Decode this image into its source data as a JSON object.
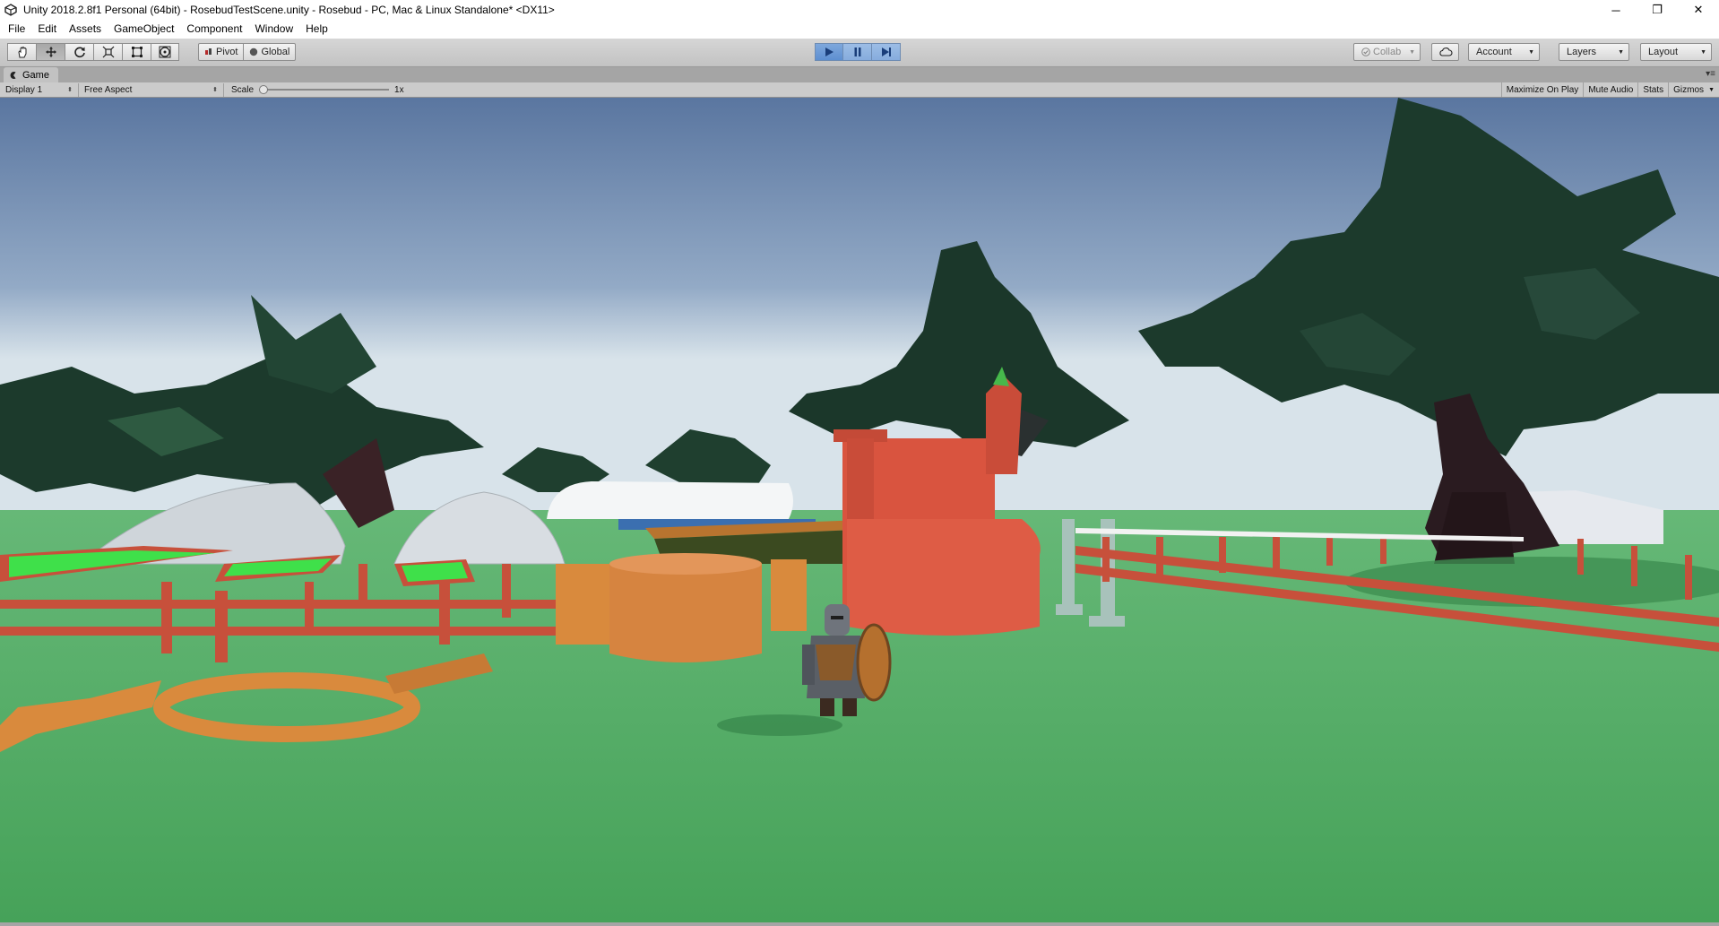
{
  "window": {
    "title": "Unity 2018.2.8f1 Personal (64bit) - RosebudTestScene.unity - Rosebud - PC, Mac & Linux Standalone* <DX11>",
    "minimize": "─",
    "maximize": "❐",
    "close": "✕"
  },
  "menu": {
    "items": [
      "File",
      "Edit",
      "Assets",
      "GameObject",
      "Component",
      "Window",
      "Help"
    ]
  },
  "toolbar": {
    "transform_tools": [
      "hand-icon",
      "move-icon",
      "rotate-icon",
      "scale-icon",
      "rect-icon",
      "transform-icon"
    ],
    "pivot_label": "Pivot",
    "global_label": "Global",
    "collab_label": "Collab",
    "account_label": "Account",
    "layers_label": "Layers",
    "layout_label": "Layout",
    "play_state": "playing"
  },
  "game_tab": {
    "label": "Game",
    "display": "Display 1",
    "aspect": "Free Aspect",
    "scale_label": "Scale",
    "scale_value": "1x",
    "maximize_on_play": "Maximize On Play",
    "mute_audio": "Mute Audio",
    "stats": "Stats",
    "gizmos": "Gizmos"
  },
  "colors": {
    "play_active": "#5d8fd1",
    "sky_top": "#5a76a0",
    "sky_bottom": "#d8e3ea",
    "grass": "#4faa5e",
    "fence": "#c7503b",
    "tree_foliage": "#1c3a2c"
  }
}
